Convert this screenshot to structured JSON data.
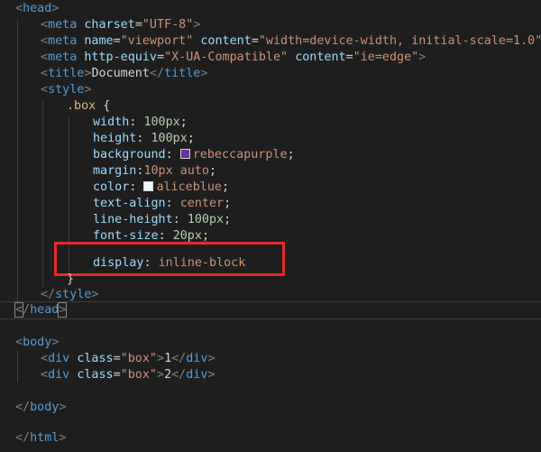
{
  "editor": {
    "l1": {
      "tag": "head"
    },
    "l2": {
      "tag": "meta",
      "attr": "charset",
      "val": "\"UTF-8\""
    },
    "l3": {
      "tag": "meta",
      "attr1": "name",
      "val1": "\"viewport\"",
      "attr2": "content",
      "val2": "\"width=device-width, initial-scale=1.0\""
    },
    "l4": {
      "tag": "meta",
      "attr1": "http-equiv",
      "val1": "\"X-UA-Compatible\"",
      "attr2": "content",
      "val2": "\"ie=edge\""
    },
    "l5": {
      "tag": "title",
      "text": "Document"
    },
    "l6": {
      "tag": "style"
    },
    "l7": {
      "selector": ".box"
    },
    "css": {
      "width": {
        "prop": "width",
        "num": "100px"
      },
      "height": {
        "prop": "height",
        "num": "100px"
      },
      "background": {
        "prop": "background",
        "val": "rebeccapurple",
        "swatch": "#663399"
      },
      "margin": {
        "prop": "margin",
        "val": "10px auto"
      },
      "color": {
        "prop": "color",
        "val": "aliceblue",
        "swatch": "#f0f8ff"
      },
      "text_align": {
        "prop": "text-align",
        "val": "center"
      },
      "line_height": {
        "prop": "line-height",
        "num": "100px"
      },
      "font_size": {
        "prop": "font-size",
        "num": "20px"
      },
      "display": {
        "prop": "display",
        "val": "inline-block"
      }
    },
    "body": {
      "tag": "body"
    },
    "div1": {
      "tag": "div",
      "attr": "class",
      "val": "\"box\"",
      "text": "1"
    },
    "div2": {
      "tag": "div",
      "attr": "class",
      "val": "\"box\"",
      "text": "2"
    },
    "html": {
      "tag": "html"
    }
  }
}
